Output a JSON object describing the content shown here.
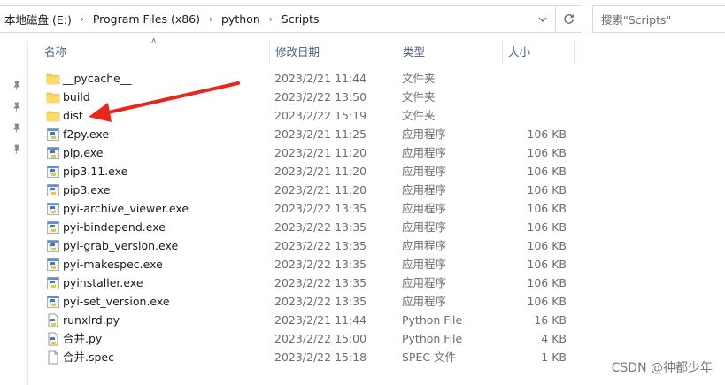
{
  "breadcrumb": {
    "items": [
      "本地磁盘 (E:)",
      "Program Files (x86)",
      "python",
      "Scripts"
    ]
  },
  "search": {
    "placeholder": "搜索\"Scripts\""
  },
  "columns": {
    "name": "名称",
    "date": "修改日期",
    "type": "类型",
    "size": "大小"
  },
  "files": [
    {
      "name": "__pycache__",
      "date": "2023/2/21 11:44",
      "type": "文件夹",
      "size": "",
      "icon": "folder-icon"
    },
    {
      "name": "build",
      "date": "2023/2/22 13:50",
      "type": "文件夹",
      "size": "",
      "icon": "folder-icon"
    },
    {
      "name": "dist",
      "date": "2023/2/22 15:19",
      "type": "文件夹",
      "size": "",
      "icon": "folder-icon"
    },
    {
      "name": "f2py.exe",
      "date": "2023/2/21 11:25",
      "type": "应用程序",
      "size": "106 KB",
      "icon": "python-exe-icon"
    },
    {
      "name": "pip.exe",
      "date": "2023/2/21 11:20",
      "type": "应用程序",
      "size": "106 KB",
      "icon": "python-exe-icon"
    },
    {
      "name": "pip3.11.exe",
      "date": "2023/2/21 11:20",
      "type": "应用程序",
      "size": "106 KB",
      "icon": "python-exe-icon"
    },
    {
      "name": "pip3.exe",
      "date": "2023/2/21 11:20",
      "type": "应用程序",
      "size": "106 KB",
      "icon": "python-exe-icon"
    },
    {
      "name": "pyi-archive_viewer.exe",
      "date": "2023/2/22 13:35",
      "type": "应用程序",
      "size": "106 KB",
      "icon": "python-exe-icon"
    },
    {
      "name": "pyi-bindepend.exe",
      "date": "2023/2/22 13:35",
      "type": "应用程序",
      "size": "106 KB",
      "icon": "python-exe-icon"
    },
    {
      "name": "pyi-grab_version.exe",
      "date": "2023/2/22 13:35",
      "type": "应用程序",
      "size": "106 KB",
      "icon": "python-exe-icon"
    },
    {
      "name": "pyi-makespec.exe",
      "date": "2023/2/22 13:35",
      "type": "应用程序",
      "size": "106 KB",
      "icon": "python-exe-icon"
    },
    {
      "name": "pyinstaller.exe",
      "date": "2023/2/22 13:35",
      "type": "应用程序",
      "size": "106 KB",
      "icon": "python-exe-icon"
    },
    {
      "name": "pyi-set_version.exe",
      "date": "2023/2/22 13:35",
      "type": "应用程序",
      "size": "106 KB",
      "icon": "python-exe-icon"
    },
    {
      "name": "runxlrd.py",
      "date": "2023/2/21 11:44",
      "type": "Python File",
      "size": "16 KB",
      "icon": "python-file-icon"
    },
    {
      "name": "合并.py",
      "date": "2023/2/22 15:00",
      "type": "Python File",
      "size": "4 KB",
      "icon": "python-file-icon"
    },
    {
      "name": "合并.spec",
      "date": "2023/2/22 15:18",
      "type": "SPEC 文件",
      "size": "1 KB",
      "icon": "document-icon"
    }
  ],
  "watermark": "CSDN @神都少年",
  "colors": {
    "folder": "#f8cf5a",
    "arrow": "#e8261b",
    "header_text": "#4c607a"
  }
}
